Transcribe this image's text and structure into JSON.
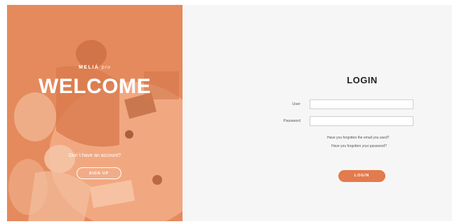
{
  "left": {
    "brand_main": "MELIÁ",
    "brand_sub": "pro",
    "welcome": "WELCOME",
    "no_account": "Don´t have an account?",
    "signup_label": "SIGN UP"
  },
  "login": {
    "title": "LOGIN",
    "user_label": "User",
    "user_value": "",
    "password_label": "Password",
    "password_value": "",
    "forgot_email": "Have you forgotten the email you used?",
    "forgot_password": "Have you forgotten your password?",
    "login_label": "LOGIN"
  },
  "colors": {
    "accent": "#e27b4d",
    "overlay": "#e58a5c",
    "background": "#f6f6f6"
  }
}
